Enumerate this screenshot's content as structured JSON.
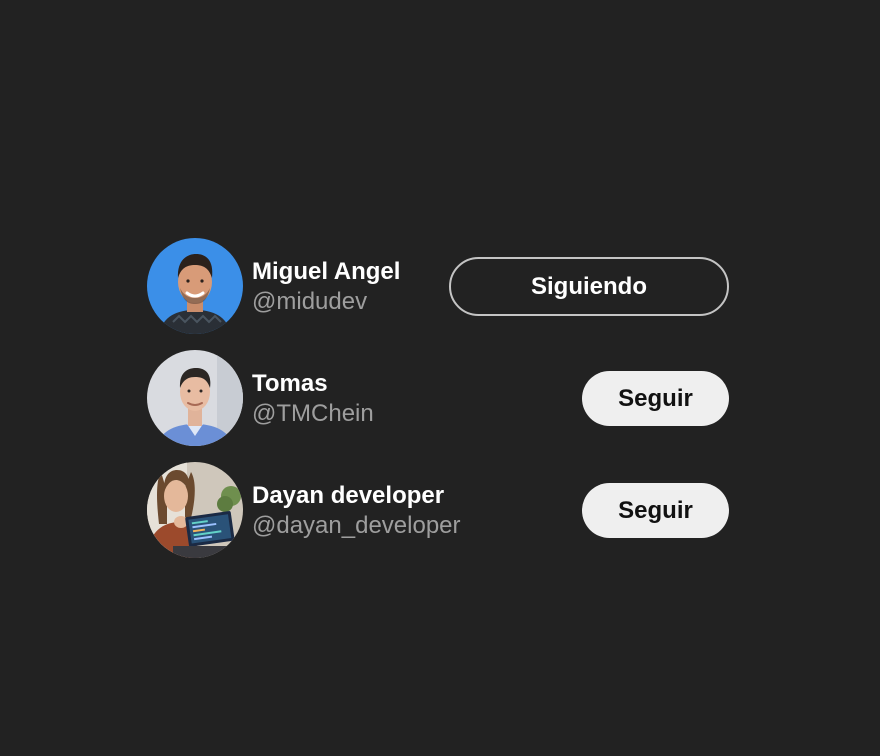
{
  "users": [
    {
      "name": "Miguel Angel",
      "handle": "@midudev",
      "button_label": "Siguiendo",
      "following": true,
      "avatar_bg": "#3b8fe8"
    },
    {
      "name": "Tomas",
      "handle": "@TMChein",
      "button_label": "Seguir",
      "following": false,
      "avatar_bg": "#d9dbe0"
    },
    {
      "name": "Dayan developer",
      "handle": "@dayan_developer",
      "button_label": "Seguir",
      "following": false,
      "avatar_bg": "#cfc7bb"
    }
  ],
  "colors": {
    "background": "#222222",
    "handle_text": "#9e9e9e",
    "follow_button_bg": "#efefef",
    "following_border": "#c4c4c4"
  }
}
